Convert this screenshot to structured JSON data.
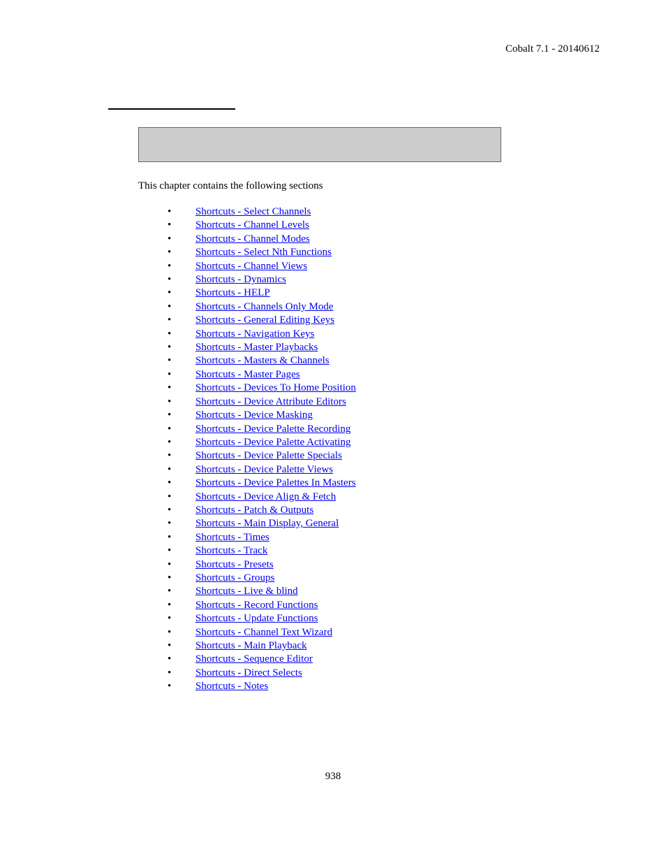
{
  "header": "Cobalt 7.1 - 20140612",
  "intro": "This chapter contains the following sections",
  "links": [
    "Shortcuts - Select Channels",
    "Shortcuts - Channel Levels",
    "Shortcuts - Channel Modes",
    "Shortcuts - Select Nth Functions",
    "Shortcuts - Channel Views",
    "Shortcuts - Dynamics",
    "Shortcuts - HELP",
    "Shortcuts - Channels Only Mode",
    "Shortcuts - General Editing Keys",
    "Shortcuts - Navigation Keys",
    "Shortcuts - Master Playbacks",
    "Shortcuts - Masters & Channels",
    "Shortcuts - Master Pages",
    "Shortcuts - Devices To Home Position",
    "Shortcuts - Device Attribute Editors",
    "Shortcuts - Device Masking",
    "Shortcuts - Device Palette Recording",
    "Shortcuts - Device Palette Activating",
    "Shortcuts - Device Palette Specials",
    "Shortcuts - Device Palette Views",
    "Shortcuts - Device Palettes In Masters",
    "Shortcuts - Device Align & Fetch",
    "Shortcuts - Patch & Outputs",
    "Shortcuts - Main Display, General",
    "Shortcuts - Times",
    "Shortcuts - Track",
    "Shortcuts - Presets",
    "Shortcuts - Groups",
    "Shortcuts - Live & blind",
    "Shortcuts - Record Functions",
    "Shortcuts - Update Functions",
    "Shortcuts - Channel Text Wizard",
    "Shortcuts - Main Playback",
    "Shortcuts - Sequence Editor",
    "Shortcuts - Direct Selects",
    "Shortcuts - Notes"
  ],
  "page_number": "938"
}
